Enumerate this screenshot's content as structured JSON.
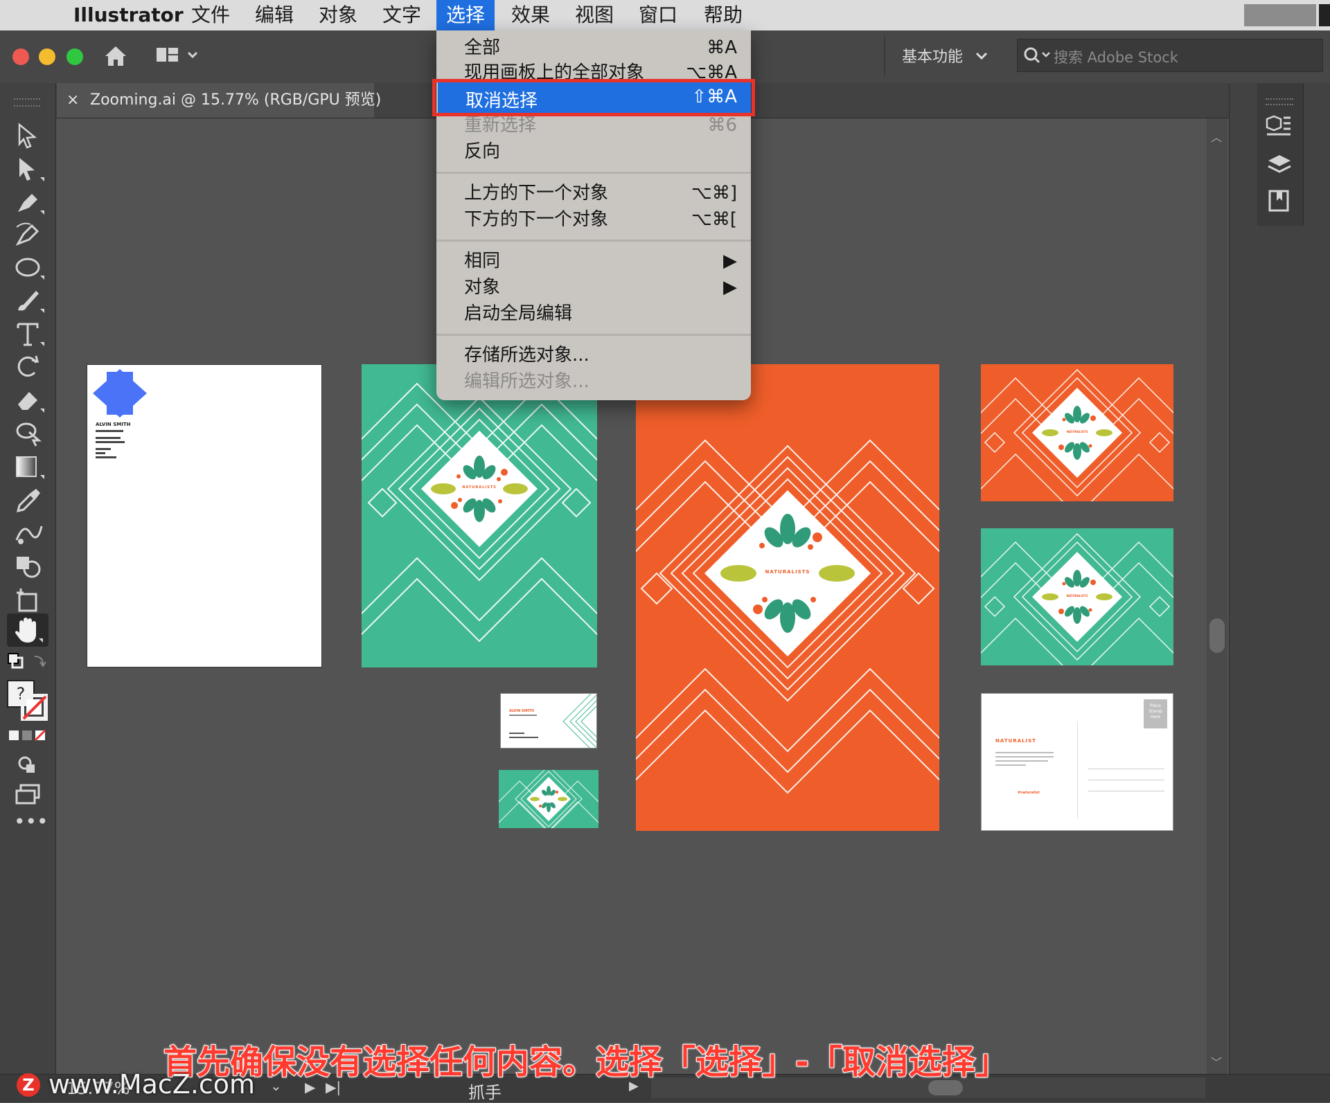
{
  "menubar": {
    "app": "Illustrator",
    "items": [
      "文件",
      "编辑",
      "对象",
      "文字",
      "选择",
      "效果",
      "视图",
      "窗口",
      "帮助"
    ],
    "active": "选择"
  },
  "appbar": {
    "workspace": "基本功能",
    "search_placeholder": "搜索 Adobe Stock"
  },
  "document_tab": {
    "close": "×",
    "title": "Zooming.ai @ 15.77% (RGB/GPU 预览)"
  },
  "select_menu": {
    "items": [
      {
        "label": "全部",
        "shortcut": "⌘A"
      },
      {
        "label": "现用画板上的全部对象",
        "shortcut": "⌥⌘A"
      },
      {
        "label": "取消选择",
        "shortcut": "⇧⌘A"
      },
      {
        "label": "重新选择",
        "shortcut": "⌘6"
      },
      {
        "label": "反向",
        "shortcut": ""
      },
      {
        "label": "上方的下一个对象",
        "shortcut": "⌥⌘]"
      },
      {
        "label": "下方的下一个对象",
        "shortcut": "⌥⌘["
      },
      {
        "label": "相同",
        "shortcut": "▶"
      },
      {
        "label": "对象",
        "shortcut": "▶"
      },
      {
        "label": "启动全局编辑",
        "shortcut": ""
      },
      {
        "label": "存储所选对象...",
        "shortcut": ""
      },
      {
        "label": "编辑所选对象...",
        "shortcut": ""
      }
    ]
  },
  "artboards": {
    "letterhead_name": "ALVIN SMITH",
    "brand": "NATURALISTS",
    "postcard_title": "NATURALIST",
    "postcard_tag": "#naturalist",
    "stamp": "Place Stamp Here",
    "business_card_name": "ALVIN SMITH"
  },
  "status": {
    "zoom": "15.77%",
    "tool": "抓手"
  },
  "caption": "首先确保没有选择任何内容。选择「选择」-「取消选择」",
  "watermark": "www.MacZ.com",
  "colors": {
    "teal": "#41b993",
    "orange": "#ef5e2a",
    "leaf_green": "#2f9b78",
    "olive": "#b9c43a",
    "highlight": "#1f6fe0",
    "callout_red": "#e8322a"
  }
}
